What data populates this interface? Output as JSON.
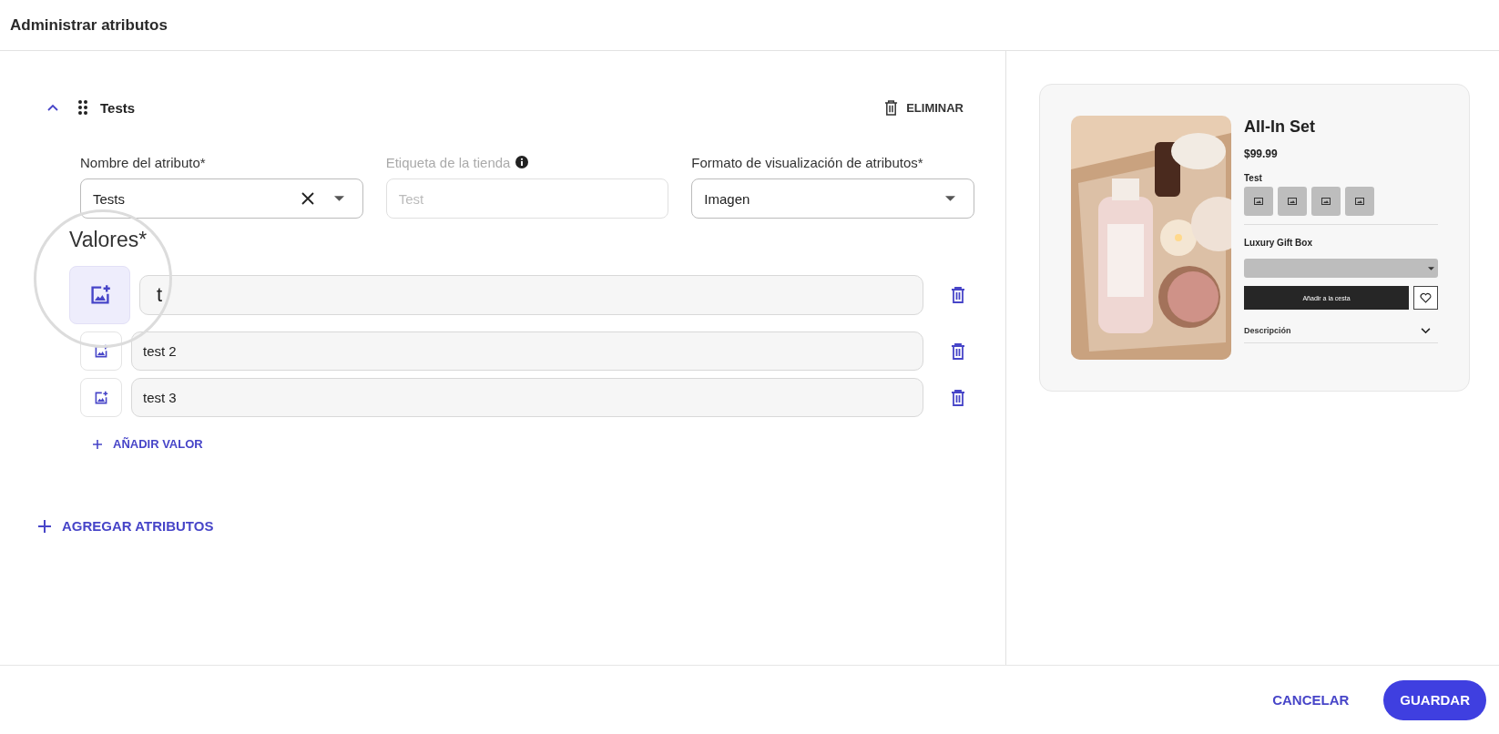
{
  "header": {
    "title": "Administrar atributos"
  },
  "attribute": {
    "name": "Tests",
    "expanded": true,
    "delete_label": "ELIMINAR",
    "fields": [
      {
        "kind": "select",
        "label": "Nombre del atributo*",
        "value": "Tests",
        "clearable": true,
        "info": false,
        "disabled": false
      },
      {
        "kind": "text",
        "label": "Etiqueta de la tienda",
        "placeholder": "Test",
        "info": true,
        "clearable": false,
        "disabled": true
      },
      {
        "kind": "select",
        "label": "Formato de visualización de atributos*",
        "value": "Imagen",
        "clearable": false,
        "info": false,
        "disabled": false
      }
    ],
    "values_label": "Valores*",
    "values": [
      {
        "value": "t",
        "magnified": true
      },
      {
        "value": "test 2",
        "magnified": false
      },
      {
        "value": "test 3",
        "magnified": false
      }
    ],
    "add_value": "AÑADIR VALOR"
  },
  "add_attributes": "AGREGAR ATRIBUTOS",
  "preview": {
    "title": "All-In Set",
    "price": "$99.99",
    "option_label": "Test",
    "section_label": "Luxury Gift Box",
    "cart_button": "Añadir a la cesta",
    "description": "Descripción"
  },
  "footer": {
    "cancel": "CANCELAR",
    "save": "GUARDAR"
  }
}
